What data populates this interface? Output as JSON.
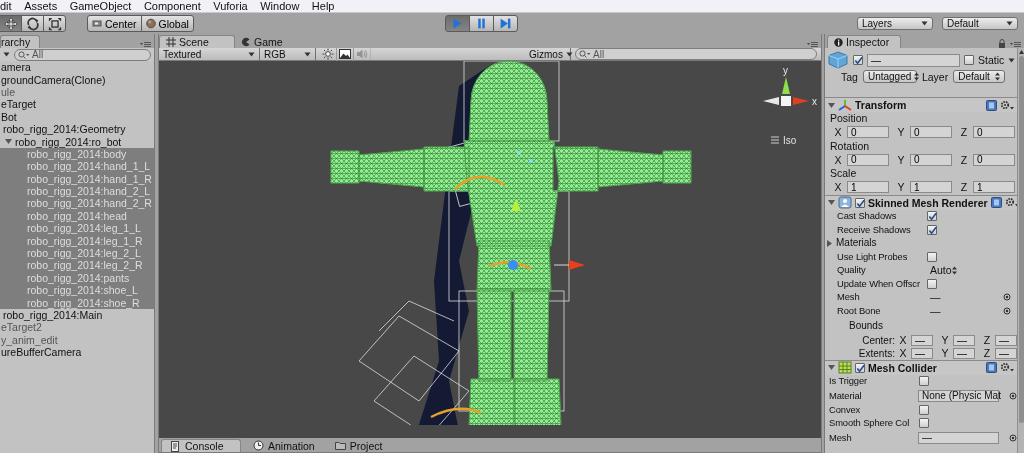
{
  "menu": [
    "dit",
    "Assets",
    "GameObject",
    "Component",
    "Vuforia",
    "Window",
    "Help"
  ],
  "toolbar": {
    "tools": [
      {
        "kind": "move",
        "selected": true
      },
      {
        "kind": "rotate",
        "selected": false
      },
      {
        "kind": "scale",
        "selected": false
      }
    ],
    "pivot": [
      {
        "kind": "center",
        "label": "Center"
      },
      {
        "kind": "global",
        "label": "Global"
      }
    ],
    "playback": [
      {
        "kind": "play",
        "selected": true
      },
      {
        "kind": "pause",
        "selected": false
      },
      {
        "kind": "step",
        "selected": false
      }
    ],
    "layers": "Layers",
    "layout": "Default"
  },
  "hierarchy": {
    "tab": "rarchy",
    "search": {
      "placeholder": "All"
    },
    "items": [
      {
        "label": "amera",
        "selected": false,
        "inactive": false
      },
      {
        "label": "groundCamera(Clone)",
        "selected": false,
        "inactive": false
      },
      {
        "label": "ule",
        "selected": false,
        "inactive": true
      },
      {
        "label": "eTarget",
        "selected": false,
        "inactive": false
      },
      {
        "label": "Bot",
        "selected": false,
        "inactive": false,
        "children": [
          {
            "label": "robo_rigg_2014:Geometry",
            "selected": false,
            "inactive": false
          },
          {
            "label": "robo_rigg_2014:ro_bot",
            "selected": false,
            "inactive": false,
            "expanded": true,
            "children": [
              {
                "label": "robo_rigg_2014:body",
                "selected": true,
                "inactive": false
              },
              {
                "label": "robo_rigg_2014:hand_1_L",
                "selected": true,
                "inactive": false
              },
              {
                "label": "robo_rigg_2014:hand_1_R",
                "selected": true,
                "inactive": false
              },
              {
                "label": "robo_rigg_2014:hand_2_L",
                "selected": true,
                "inactive": false
              },
              {
                "label": "robo_rigg_2014:hand_2_R",
                "selected": true,
                "inactive": false
              },
              {
                "label": "robo_rigg_2014:head",
                "selected": true,
                "inactive": false
              },
              {
                "label": "robo_rigg_2014:leg_1_L",
                "selected": true,
                "inactive": false
              },
              {
                "label": "robo_rigg_2014:leg_1_R",
                "selected": true,
                "inactive": false
              },
              {
                "label": "robo_rigg_2014:leg_2_L",
                "selected": true,
                "inactive": false
              },
              {
                "label": "robo_rigg_2014:leg_2_R",
                "selected": true,
                "inactive": false
              },
              {
                "label": "robo_rigg_2014:pants",
                "selected": true,
                "inactive": false
              },
              {
                "label": "robo_rigg_2014:shoe_L",
                "selected": true,
                "inactive": false
              },
              {
                "label": "robo_rigg_2014:shoe_R",
                "selected": true,
                "inactive": false
              }
            ]
          },
          {
            "label": "robo_rigg_2014:Main",
            "selected": false,
            "inactive": false
          }
        ]
      },
      {
        "label": "eTarget2",
        "selected": false,
        "inactive": true
      },
      {
        "label": "y_anim_edit",
        "selected": false,
        "inactive": true
      },
      {
        "label": "ureBufferCamera",
        "selected": false,
        "inactive": false
      }
    ]
  },
  "scene": {
    "tabs": [
      {
        "kind": "scene",
        "label": "Scene",
        "selected": true
      },
      {
        "kind": "game",
        "label": "Game",
        "selected": false
      }
    ],
    "render_mode": "Textured",
    "color_mode": "RGB",
    "toggles": [
      {
        "kind": "lighting",
        "disabled": false
      },
      {
        "kind": "image",
        "disabled": false
      },
      {
        "kind": "audio",
        "disabled": true
      }
    ],
    "gizmos": "Gizmos",
    "search": {
      "placeholder": "All"
    },
    "gizmo": {
      "y": "y",
      "x": "x",
      "projection": "Iso"
    }
  },
  "bottom_tabs": [
    {
      "kind": "console",
      "label": "Console",
      "selected": true
    },
    {
      "kind": "animation",
      "label": "Animation",
      "selected": false
    },
    {
      "kind": "project",
      "label": "Project",
      "selected": false
    }
  ],
  "inspector": {
    "tab": "Inspector",
    "object": {
      "enabled": true,
      "name": "—",
      "static": false,
      "static_label": "Static",
      "tag_label": "Tag",
      "tag": "Untagged",
      "layer_label": "Layer",
      "layer": "Default"
    },
    "components": [
      {
        "kind": "transform",
        "title": "Transform",
        "expanded": true,
        "groups": [
          {
            "label": "Position",
            "fields": [
              {
                "axis": "X",
                "value": "0"
              },
              {
                "axis": "Y",
                "value": "0"
              },
              {
                "axis": "Z",
                "value": "0"
              }
            ]
          },
          {
            "label": "Rotation",
            "fields": [
              {
                "axis": "X",
                "value": "0"
              },
              {
                "axis": "Y",
                "value": "0"
              },
              {
                "axis": "Z",
                "value": "0"
              }
            ]
          },
          {
            "label": "Scale",
            "fields": [
              {
                "axis": "X",
                "value": "1"
              },
              {
                "axis": "Y",
                "value": "1"
              },
              {
                "axis": "Z",
                "value": "1"
              }
            ]
          }
        ]
      },
      {
        "kind": "skinned",
        "title": "Skinned Mesh Renderer",
        "expanded": true,
        "enabled": true,
        "properties": [
          {
            "kind": "checkbox",
            "label": "Cast Shadows",
            "checked": true
          },
          {
            "kind": "checkbox",
            "label": "Receive Shadows",
            "checked": true
          },
          {
            "kind": "foldout",
            "label": "Materials",
            "expanded": false
          },
          {
            "kind": "checkbox",
            "label": "Use Light Probes",
            "checked": false
          },
          {
            "kind": "dropdown",
            "label": "Quality",
            "value": "Auto"
          },
          {
            "kind": "checkbox",
            "label": "Update When Offscr",
            "checked": false
          },
          {
            "kind": "object",
            "label": "Mesh",
            "value": "—"
          },
          {
            "kind": "object",
            "label": "Root Bone",
            "value": "—"
          },
          {
            "kind": "heading",
            "label": "Bounds"
          },
          {
            "kind": "vector",
            "label": "Center:",
            "fields": [
              {
                "axis": "X",
                "value": "—"
              },
              {
                "axis": "Y",
                "value": "—"
              },
              {
                "axis": "Z",
                "value": "—"
              }
            ]
          },
          {
            "kind": "vector",
            "label": "Extents:",
            "fields": [
              {
                "axis": "X",
                "value": "—"
              },
              {
                "axis": "Y",
                "value": "—"
              },
              {
                "axis": "Z",
                "value": "—"
              }
            ]
          }
        ]
      },
      {
        "kind": "collider",
        "title": "Mesh Collider",
        "expanded": true,
        "enabled": true,
        "properties": [
          {
            "kind": "checkbox",
            "label": "Is Trigger",
            "checked": false
          },
          {
            "kind": "objectfield",
            "label": "Material",
            "value": "None (Physic Mat"
          },
          {
            "kind": "checkbox",
            "label": "Convex",
            "checked": false
          },
          {
            "kind": "checkbox",
            "label": "Smooth Sphere Col",
            "checked": false
          },
          {
            "kind": "objectfield",
            "label": "Mesh",
            "value": "—"
          }
        ]
      }
    ]
  }
}
